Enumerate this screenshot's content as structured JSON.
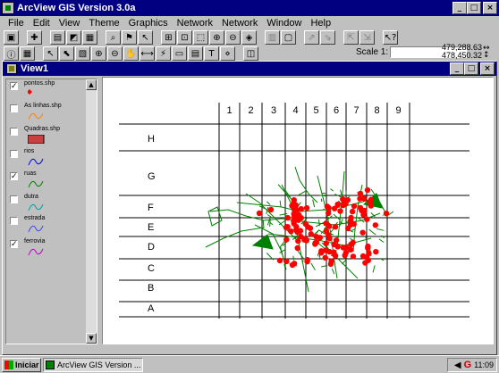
{
  "app": {
    "title": "ArcView GIS Version 3.0a",
    "window_buttons": [
      "_",
      "□",
      "×"
    ]
  },
  "menubar": {
    "items": [
      "File",
      "Edit",
      "View",
      "Theme",
      "Graphics",
      "Network",
      "Network",
      "Window",
      "Help"
    ]
  },
  "toolbar2": {
    "scale_label": "Scale 1:",
    "scale_value": "",
    "coord_x": "479,288.63",
    "coord_y": "478,450.32"
  },
  "view": {
    "title": "View1"
  },
  "toc": {
    "themes": [
      {
        "name": "pontos.shp",
        "checked": true,
        "symbol": "point",
        "color": "#ff0000"
      },
      {
        "name": "As linhas.shp",
        "checked": false,
        "symbol": "line",
        "color": "#ff8000"
      },
      {
        "name": "Quadras.shp",
        "checked": false,
        "symbol": "polygon",
        "color": "#c84040"
      },
      {
        "name": "rios",
        "checked": false,
        "symbol": "line",
        "color": "#0000ff"
      },
      {
        "name": "ruas",
        "checked": true,
        "symbol": "line",
        "color": "#008000"
      },
      {
        "name": "dutra",
        "checked": false,
        "symbol": "line",
        "color": "#00a0a0"
      },
      {
        "name": "estrada",
        "checked": false,
        "symbol": "line",
        "color": "#4040ff"
      },
      {
        "name": "ferrovia",
        "checked": true,
        "symbol": "line",
        "color": "#c000c0"
      }
    ]
  },
  "map": {
    "column_labels": [
      "1",
      "2",
      "3",
      "4",
      "5",
      "6",
      "7",
      "8",
      "9"
    ],
    "row_labels": [
      "H",
      "G",
      "F",
      "E",
      "D",
      "C",
      "B",
      "A"
    ],
    "colors": {
      "points": "#ff0000",
      "streets": "#008000",
      "grid": "#000000"
    }
  },
  "taskbar": {
    "start_label": "Iniciar",
    "task_label": "ArcView GIS Version ...",
    "clock": "11:09"
  }
}
